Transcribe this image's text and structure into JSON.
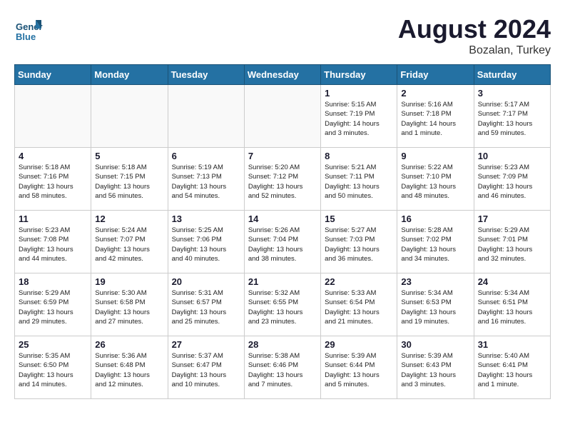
{
  "header": {
    "logo_line1": "General",
    "logo_line2": "Blue",
    "month_year": "August 2024",
    "location": "Bozalan, Turkey"
  },
  "weekdays": [
    "Sunday",
    "Monday",
    "Tuesday",
    "Wednesday",
    "Thursday",
    "Friday",
    "Saturday"
  ],
  "weeks": [
    [
      {
        "day": "",
        "info": ""
      },
      {
        "day": "",
        "info": ""
      },
      {
        "day": "",
        "info": ""
      },
      {
        "day": "",
        "info": ""
      },
      {
        "day": "1",
        "info": "Sunrise: 5:15 AM\nSunset: 7:19 PM\nDaylight: 14 hours\nand 3 minutes."
      },
      {
        "day": "2",
        "info": "Sunrise: 5:16 AM\nSunset: 7:18 PM\nDaylight: 14 hours\nand 1 minute."
      },
      {
        "day": "3",
        "info": "Sunrise: 5:17 AM\nSunset: 7:17 PM\nDaylight: 13 hours\nand 59 minutes."
      }
    ],
    [
      {
        "day": "4",
        "info": "Sunrise: 5:18 AM\nSunset: 7:16 PM\nDaylight: 13 hours\nand 58 minutes."
      },
      {
        "day": "5",
        "info": "Sunrise: 5:18 AM\nSunset: 7:15 PM\nDaylight: 13 hours\nand 56 minutes."
      },
      {
        "day": "6",
        "info": "Sunrise: 5:19 AM\nSunset: 7:13 PM\nDaylight: 13 hours\nand 54 minutes."
      },
      {
        "day": "7",
        "info": "Sunrise: 5:20 AM\nSunset: 7:12 PM\nDaylight: 13 hours\nand 52 minutes."
      },
      {
        "day": "8",
        "info": "Sunrise: 5:21 AM\nSunset: 7:11 PM\nDaylight: 13 hours\nand 50 minutes."
      },
      {
        "day": "9",
        "info": "Sunrise: 5:22 AM\nSunset: 7:10 PM\nDaylight: 13 hours\nand 48 minutes."
      },
      {
        "day": "10",
        "info": "Sunrise: 5:23 AM\nSunset: 7:09 PM\nDaylight: 13 hours\nand 46 minutes."
      }
    ],
    [
      {
        "day": "11",
        "info": "Sunrise: 5:23 AM\nSunset: 7:08 PM\nDaylight: 13 hours\nand 44 minutes."
      },
      {
        "day": "12",
        "info": "Sunrise: 5:24 AM\nSunset: 7:07 PM\nDaylight: 13 hours\nand 42 minutes."
      },
      {
        "day": "13",
        "info": "Sunrise: 5:25 AM\nSunset: 7:06 PM\nDaylight: 13 hours\nand 40 minutes."
      },
      {
        "day": "14",
        "info": "Sunrise: 5:26 AM\nSunset: 7:04 PM\nDaylight: 13 hours\nand 38 minutes."
      },
      {
        "day": "15",
        "info": "Sunrise: 5:27 AM\nSunset: 7:03 PM\nDaylight: 13 hours\nand 36 minutes."
      },
      {
        "day": "16",
        "info": "Sunrise: 5:28 AM\nSunset: 7:02 PM\nDaylight: 13 hours\nand 34 minutes."
      },
      {
        "day": "17",
        "info": "Sunrise: 5:29 AM\nSunset: 7:01 PM\nDaylight: 13 hours\nand 32 minutes."
      }
    ],
    [
      {
        "day": "18",
        "info": "Sunrise: 5:29 AM\nSunset: 6:59 PM\nDaylight: 13 hours\nand 29 minutes."
      },
      {
        "day": "19",
        "info": "Sunrise: 5:30 AM\nSunset: 6:58 PM\nDaylight: 13 hours\nand 27 minutes."
      },
      {
        "day": "20",
        "info": "Sunrise: 5:31 AM\nSunset: 6:57 PM\nDaylight: 13 hours\nand 25 minutes."
      },
      {
        "day": "21",
        "info": "Sunrise: 5:32 AM\nSunset: 6:55 PM\nDaylight: 13 hours\nand 23 minutes."
      },
      {
        "day": "22",
        "info": "Sunrise: 5:33 AM\nSunset: 6:54 PM\nDaylight: 13 hours\nand 21 minutes."
      },
      {
        "day": "23",
        "info": "Sunrise: 5:34 AM\nSunset: 6:53 PM\nDaylight: 13 hours\nand 19 minutes."
      },
      {
        "day": "24",
        "info": "Sunrise: 5:34 AM\nSunset: 6:51 PM\nDaylight: 13 hours\nand 16 minutes."
      }
    ],
    [
      {
        "day": "25",
        "info": "Sunrise: 5:35 AM\nSunset: 6:50 PM\nDaylight: 13 hours\nand 14 minutes."
      },
      {
        "day": "26",
        "info": "Sunrise: 5:36 AM\nSunset: 6:48 PM\nDaylight: 13 hours\nand 12 minutes."
      },
      {
        "day": "27",
        "info": "Sunrise: 5:37 AM\nSunset: 6:47 PM\nDaylight: 13 hours\nand 10 minutes."
      },
      {
        "day": "28",
        "info": "Sunrise: 5:38 AM\nSunset: 6:46 PM\nDaylight: 13 hours\nand 7 minutes."
      },
      {
        "day": "29",
        "info": "Sunrise: 5:39 AM\nSunset: 6:44 PM\nDaylight: 13 hours\nand 5 minutes."
      },
      {
        "day": "30",
        "info": "Sunrise: 5:39 AM\nSunset: 6:43 PM\nDaylight: 13 hours\nand 3 minutes."
      },
      {
        "day": "31",
        "info": "Sunrise: 5:40 AM\nSunset: 6:41 PM\nDaylight: 13 hours\nand 1 minute."
      }
    ]
  ]
}
